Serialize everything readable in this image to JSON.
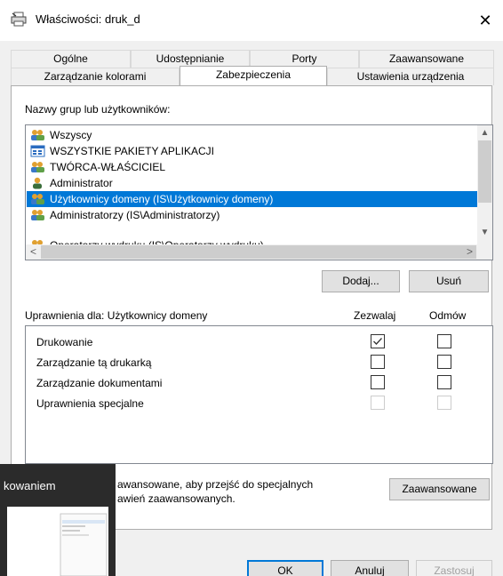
{
  "window": {
    "title": "Właściwości: druk_d",
    "close_glyph": "✕",
    "icon": "printer-icon"
  },
  "tabs_row1": [
    {
      "label": "Ogólne"
    },
    {
      "label": "Udostępnianie"
    },
    {
      "label": "Porty"
    },
    {
      "label": "Zaawansowane"
    }
  ],
  "tabs_row2": [
    {
      "label": "Zarządzanie kolorami",
      "active": false
    },
    {
      "label": "Zabezpieczenia",
      "active": true
    },
    {
      "label": "Ustawienia urządzenia",
      "active": false
    }
  ],
  "groups": {
    "label": "Nazwy grup lub użytkowników:",
    "items": [
      {
        "label": "Wszyscy",
        "icon": "group-icon",
        "selected": false
      },
      {
        "label": "WSZYSTKIE PAKIETY APLIKACJI",
        "icon": "app-packages-icon",
        "selected": false
      },
      {
        "label": "TWÓRCA-WŁAŚCICIEL",
        "icon": "group-icon",
        "selected": false
      },
      {
        "label": "Administrator",
        "icon": "user-icon",
        "selected": false
      },
      {
        "label": "Użytkownicy domeny (IS\\Użytkownicy domeny)",
        "icon": "group-icon",
        "selected": true
      },
      {
        "label": "Administratorzy (IS\\Administratorzy)",
        "icon": "group-icon",
        "selected": false
      },
      {
        "label": "Operatorzy wydruku (IS\\Operatorzy wydruku)",
        "icon": "group-icon",
        "selected": false
      }
    ],
    "scroll_up": "▲",
    "scroll_down": "▼",
    "scroll_left": "<",
    "scroll_right": ">"
  },
  "buttons": {
    "add": "Dodaj...",
    "remove": "Usuń",
    "advanced": "Zaawansowane",
    "ok": "OK",
    "cancel": "Anuluj",
    "apply": "Zastosuj"
  },
  "permissions": {
    "label": "Uprawnienia dla: Użytkownicy domeny",
    "allow_header": "Zezwalaj",
    "deny_header": "Odmów",
    "rows": [
      {
        "name": "Drukowanie",
        "allow": true,
        "deny": false,
        "disabled": false
      },
      {
        "name": "Zarządzanie tą drukarką",
        "allow": false,
        "deny": false,
        "disabled": false
      },
      {
        "name": "Zarządzanie dokumentami",
        "allow": false,
        "deny": false,
        "disabled": false
      },
      {
        "name": "Uprawnienia specjalne",
        "allow": false,
        "deny": false,
        "disabled": true
      }
    ]
  },
  "advanced_hint": {
    "line1": "awansowane, aby przejść do specjalnych",
    "line2": "awień zaawansowanych."
  },
  "taskbar_thumbnail": {
    "title": "kowaniem"
  }
}
